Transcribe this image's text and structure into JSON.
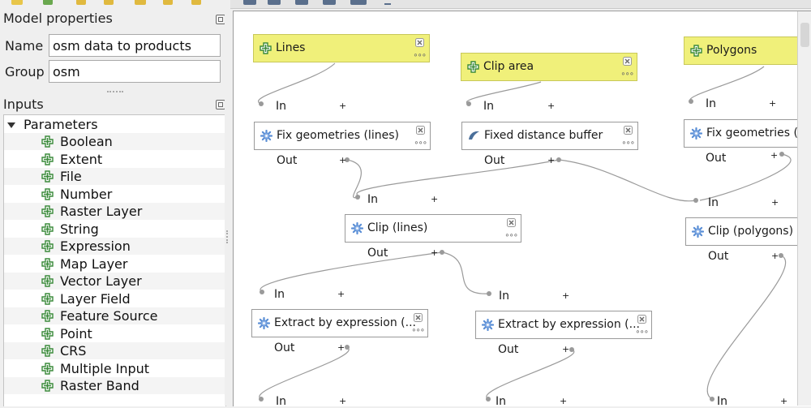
{
  "model_properties": {
    "title": "Model properties",
    "name_label": "Name",
    "name_value": "osm data to products",
    "group_label": "Group",
    "group_value": "osm"
  },
  "inputs": {
    "title": "Inputs",
    "root_label": "Parameters",
    "items": [
      {
        "label": "Boolean"
      },
      {
        "label": "Extent"
      },
      {
        "label": "File"
      },
      {
        "label": "Number"
      },
      {
        "label": "Raster Layer"
      },
      {
        "label": "String"
      },
      {
        "label": "Expression"
      },
      {
        "label": "Map Layer"
      },
      {
        "label": "Vector Layer"
      },
      {
        "label": "Layer Field"
      },
      {
        "label": "Feature Source"
      },
      {
        "label": "Point"
      },
      {
        "label": "CRS"
      },
      {
        "label": "Multiple Input"
      },
      {
        "label": "Raster Band"
      }
    ]
  },
  "canvas": {
    "port_in": "In",
    "port_out": "Out",
    "port_plus": "+",
    "more_dots": "∘∘∘",
    "inputs": {
      "lines": "Lines",
      "clip_area": "Clip area",
      "polygons": "Polygons"
    },
    "algorithms": {
      "fix_lines": "Fix geometries (lines)",
      "fixed_buffer": "Fixed distance buffer",
      "fix_polygons": "Fix geometries (p",
      "clip_lines": "Clip (lines)",
      "clip_polygons": "Clip (polygons)",
      "extract_1": "Extract by expression (...",
      "extract_2": "Extract by expression (..."
    }
  },
  "colors": {
    "input_fill": "#f0f07a",
    "add_icon": "#3a8a3a",
    "gear_icon": "#5b8fd6",
    "wire": "#9a9a9a"
  }
}
